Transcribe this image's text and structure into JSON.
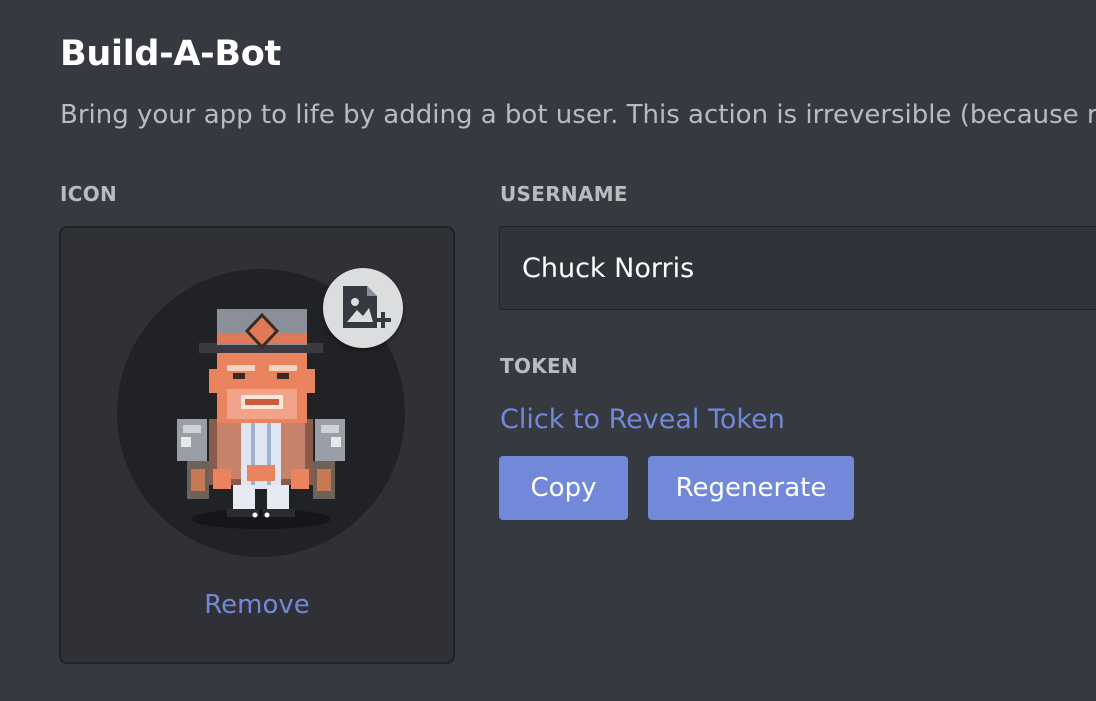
{
  "header": {
    "title": "Build-A-Bot",
    "description": "Bring your app to life by adding a bot user. This action is irreversible (because r"
  },
  "icon_section": {
    "label": "ICON",
    "avatar_icon": "bot-avatar-image",
    "upload_icon": "add-image-icon",
    "remove_label": "Remove"
  },
  "username_section": {
    "label": "USERNAME",
    "value": "Chuck Norris"
  },
  "token_section": {
    "label": "TOKEN",
    "reveal_label": "Click to Reveal Token",
    "copy_label": "Copy",
    "regenerate_label": "Regenerate"
  },
  "colors": {
    "background": "#36393f",
    "panel": "#2f3136",
    "accent": "#7289da",
    "text_muted": "#b9bbbe",
    "text_bright": "#ffffff"
  }
}
